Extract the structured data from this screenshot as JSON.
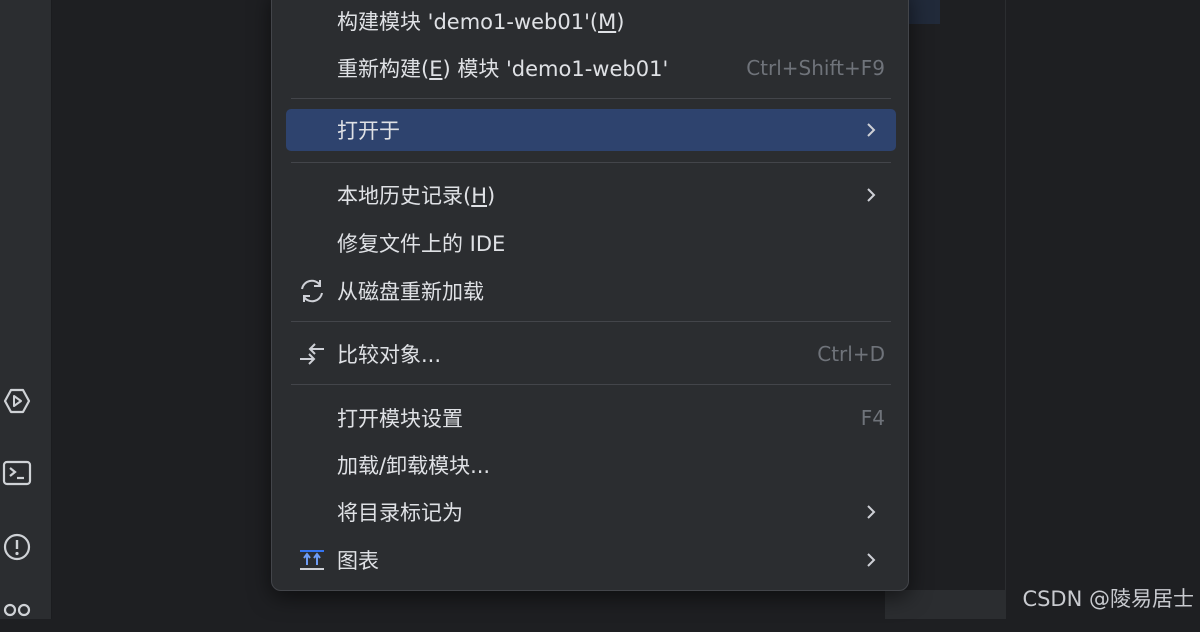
{
  "menu": {
    "items": [
      {
        "label": "构建模块 'demo1-web01'(",
        "mnemonic": "M",
        "label_tail": ")",
        "shortcut": ""
      },
      {
        "label": "重新构建(",
        "mnemonic": "E",
        "label_tail": ") 模块 'demo1-web01'",
        "shortcut": "Ctrl+Shift+F9"
      },
      {
        "label": "打开于",
        "has_submenu": true,
        "selected": true
      },
      {
        "label": "本地历史记录(",
        "mnemonic": "H",
        "label_tail": ")",
        "has_submenu": true
      },
      {
        "label": "修复文件上的 IDE"
      },
      {
        "label": "从磁盘重新加载",
        "icon": "reload-icon"
      },
      {
        "label": "比较对象...",
        "icon": "compare-icon",
        "shortcut": "Ctrl+D"
      },
      {
        "label": "打开模块设置",
        "shortcut": "F4"
      },
      {
        "label": "加载/卸载模块..."
      },
      {
        "label": "将目录标记为",
        "has_submenu": true
      },
      {
        "label": "图表",
        "icon": "diagram-icon",
        "has_submenu": true
      }
    ]
  },
  "left_toolbar": {
    "icons": [
      "run-services-icon",
      "terminal-icon",
      "problems-icon",
      "git-icon"
    ]
  },
  "watermark": "CSDN @陵易居士",
  "colors": {
    "menu_bg": "#2b2d30",
    "selection": "#2e436e",
    "text": "#dfe1e5",
    "shortcut": "#6f737a",
    "separator": "#43454a"
  }
}
